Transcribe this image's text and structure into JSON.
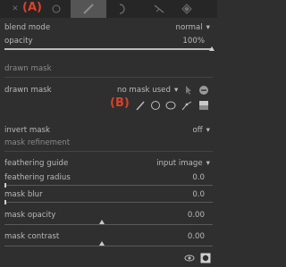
{
  "callouts": {
    "a": "(A)",
    "b": "(B)"
  },
  "blend_mode": {
    "label": "blend mode",
    "value": "normal"
  },
  "opacity": {
    "label": "opacity",
    "value": "100%"
  },
  "drawn_mask_section": "drawn mask",
  "drawn_mask": {
    "label": "drawn mask",
    "value": "no mask used"
  },
  "invert_mask": {
    "label": "invert mask",
    "value": "off"
  },
  "mask_refinement_section": "mask refinement",
  "feathering_guide": {
    "label": "feathering guide",
    "value": "input image"
  },
  "feathering_radius": {
    "label": "feathering radius",
    "value": "0.0"
  },
  "mask_blur": {
    "label": "mask blur",
    "value": "0.0"
  },
  "mask_opacity": {
    "label": "mask opacity",
    "value": "0.00"
  },
  "mask_contrast": {
    "label": "mask contrast",
    "value": "0.00"
  },
  "icons": {
    "tabs": [
      "close-icon",
      "circle-icon",
      "brush-icon",
      "half-circle-icon",
      "parametric-icon",
      "drawn-parametric-icon"
    ],
    "shapes": [
      "brush-icon",
      "circle-icon",
      "ellipse-icon",
      "path-icon",
      "gradient-icon"
    ]
  }
}
